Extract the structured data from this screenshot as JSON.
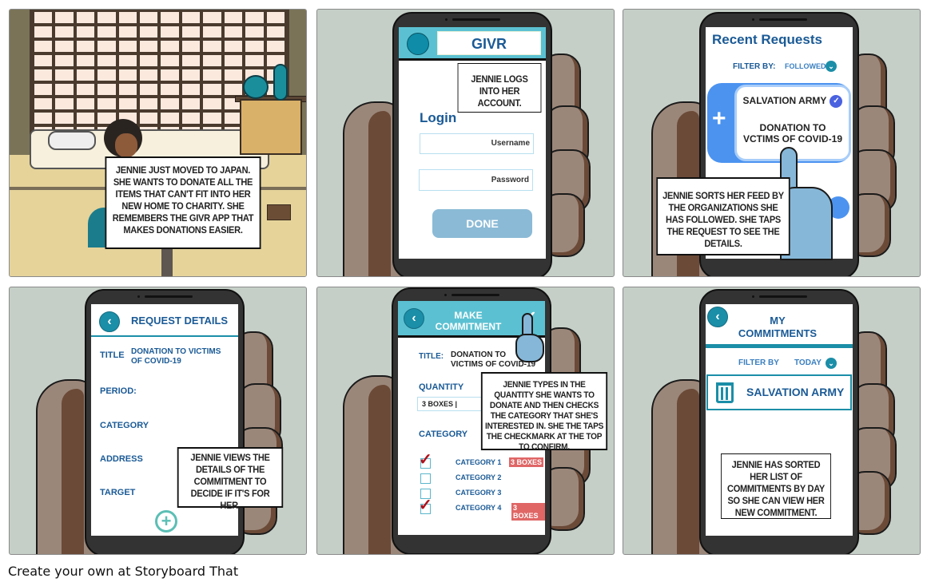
{
  "panels": [
    {
      "id": 1,
      "caption": "JENNIE JUST MOVED TO JAPAN. SHE WANTS TO DONATE ALL THE ITEMS THAT CAN'T FIT INTO HER NEW HOME TO CHARITY. SHE REMEMBERS THE GIVR APP THAT MAKES DONATIONS EASIER."
    },
    {
      "id": 2,
      "caption": "JENNIE LOGS INTO HER ACCOUNT.",
      "app": {
        "title": "GIVR",
        "login_heading": "Login",
        "username_placeholder": "Username",
        "password_placeholder": "Password",
        "done_label": "DONE"
      }
    },
    {
      "id": 3,
      "caption": "JENNIE SORTS HER FEED BY THE ORGANIZATIONS SHE HAS FOLLOWED. SHE TAPS THE REQUEST TO SEE THE DETAILS.",
      "app": {
        "heading": "Recent Requests",
        "filter_label": "FILTER BY:",
        "filter_value": "FOLLOWED",
        "card": {
          "org": "SALVATION ARMY",
          "plus": "+",
          "line1": "DONATION TO",
          "line2": "VCTIMS OF COVID-19"
        }
      }
    },
    {
      "id": 4,
      "caption": "JENNIE VIEWS THE DETAILS OF  THE COMMITMENT TO DECIDE IF IT'S FOR HER.",
      "app": {
        "heading": "REQUEST DETAILS",
        "fields": [
          {
            "label": "TITLE",
            "value": "DONATION TO VICTIMS OF COVID-19"
          },
          {
            "label": "PERIOD:",
            "value": ""
          },
          {
            "label": "CATEGORY",
            "value": ""
          },
          {
            "label": "ADDRESS",
            "value": ""
          },
          {
            "label": "TARGET",
            "value": ""
          }
        ],
        "add_icon": "+"
      }
    },
    {
      "id": 5,
      "caption": "JENNIE TYPES IN THE QUANTITY SHE WANTS TO DONATE AND THEN CHECKS THE CATEGORY THAT SHE'S INTERESTED IN.  SHE THE TAPS THE CHECKMARK AT THE TOP TO CONFIRM.",
      "app": {
        "heading_line1": "MAKE",
        "heading_line2": "COMMITMENT",
        "title_label": "TITLE:",
        "title_line1": "DONATION TO",
        "title_line2": "VICTIMS OF COVID-19",
        "quantity_label": "QUANTITY",
        "quantity_value": "3 BOXES |",
        "category_label": "CATEGORY",
        "categories": [
          {
            "label": "CATEGORY 1",
            "checked": true,
            "tag": "3 BOXES"
          },
          {
            "label": "CATEGORY 2",
            "checked": false,
            "tag": ""
          },
          {
            "label": "CATEGORY 3",
            "checked": false,
            "tag": ""
          },
          {
            "label": "CATEGORY 4",
            "checked": true,
            "tag": "3 BOXES"
          }
        ]
      }
    },
    {
      "id": 6,
      "caption": "JENNIE HAS SORTED HER LIST OF COMMITMENTS BY DAY SO SHE CAN VIEW HER NEW COMMITMENT.",
      "app": {
        "heading_line1": "MY",
        "heading_line2": "COMMITMENTS",
        "filter_label": "FILTER BY",
        "filter_value": "TODAY",
        "item": "SALVATION ARMY"
      }
    }
  ],
  "icons": {
    "back": "‹",
    "chevron": "⌄",
    "check": "✓",
    "plus": "+"
  },
  "colors": {
    "app_blue": "#1a5a96",
    "teal": "#5bc1d2",
    "card_blue": "#4c93f0",
    "tag_red": "#e06666",
    "check_red": "#b0101a",
    "done_button": "#8bbad6"
  },
  "footer": {
    "watermark": "Create your own at Storyboard That"
  }
}
